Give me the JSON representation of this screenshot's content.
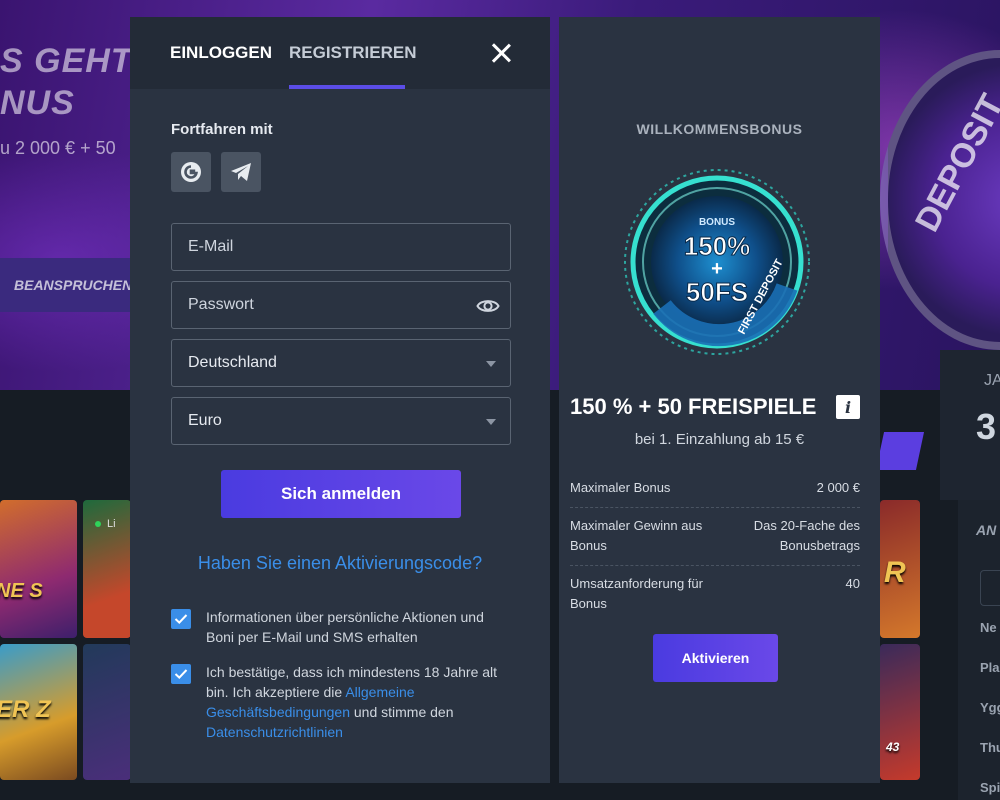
{
  "background": {
    "hero_title_line1": "S GEHT'",
    "hero_title_line2": "NUS",
    "hero_subtitle": "u 2 000 € + 50",
    "hero_button": "BEANSPRUCHEN",
    "deposit_text": "DEPOSIT",
    "right_small": "JA",
    "right_big": "3",
    "tiles": {
      "a": "NE S",
      "b_live": "Li",
      "c": "ER Z",
      "e": "R",
      "f": "43"
    },
    "right_panel": {
      "heading": "AN",
      "items": [
        "Ne",
        "Pla",
        "Ygg",
        "Thu",
        "Spi"
      ]
    }
  },
  "modal": {
    "tabs": {
      "login": "EINLOGGEN",
      "register": "REGISTRIEREN"
    },
    "continue_label": "Fortfahren mit",
    "form": {
      "email_placeholder": "E-Mail",
      "password_placeholder": "Passwort",
      "country": "Deutschland",
      "currency": "Euro",
      "submit": "Sich anmelden"
    },
    "activation_link": "Haben Sie einen Aktivierungscode?",
    "checkbox1_text": "Informationen über persönliche Aktionen und Boni per E-Mail und SMS erhalten",
    "checkbox2": {
      "text_before": "Ich bestätige, dass ich mindestens 18 Jahre alt bin. Ich akzeptiere die ",
      "link1": "Allgemeine Geschäftsbedingungen",
      "text_middle": " und stimme den ",
      "link2": "Datenschutzrichtlinien"
    }
  },
  "bonus": {
    "header": "WILLKOMMENSBONUS",
    "graphic": {
      "bonus_label": "BONUS",
      "percent": "150%",
      "plus": "+",
      "fs": "50FS",
      "ribbon": "FIRST DEPOSIT"
    },
    "title": "150 % + 50 FREISPIELE",
    "subtitle": "bei 1. Einzahlung ab 15 €",
    "rows": [
      {
        "label": "Maximaler Bonus",
        "value": "2 000 €"
      },
      {
        "label": "Maximaler Gewinn aus Bonus",
        "value": "Das 20-Fache des Bonusbetrags"
      },
      {
        "label": "Umsatzanforderung für Bonus",
        "value": "40"
      }
    ],
    "activate_button": "Aktivieren"
  },
  "colors": {
    "accent": "#5b4de6",
    "link": "#3a8ee8",
    "panel": "#2a3341",
    "header": "#232b37"
  }
}
